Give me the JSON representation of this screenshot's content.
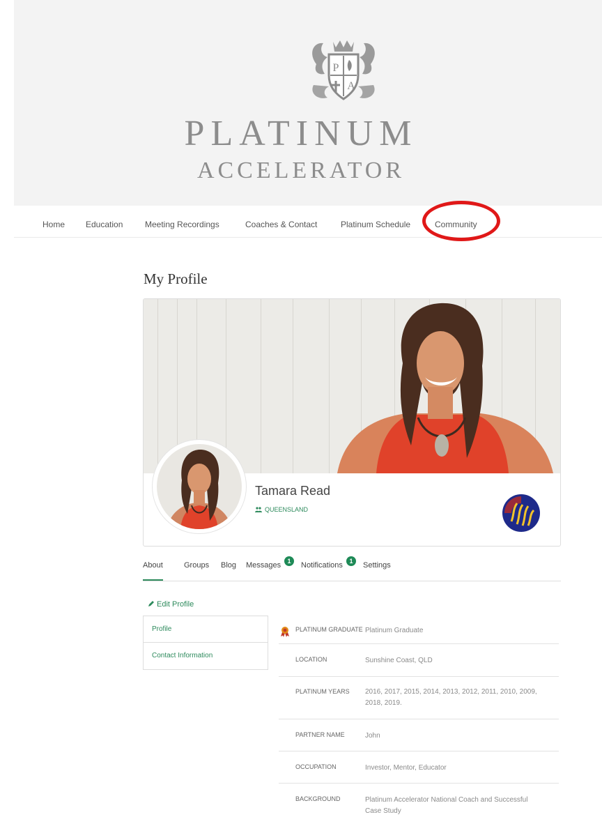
{
  "brand": {
    "line1": "PLATINUM",
    "line2": "ACCELERATOR",
    "crest_icon": "crest-icon"
  },
  "nav": {
    "items": [
      "Home",
      "Education",
      "Meeting Recordings",
      "Coaches & Contact",
      "Platinum Schedule",
      "Community"
    ],
    "highlighted": "Community"
  },
  "page": {
    "title": "My Profile"
  },
  "profile": {
    "name": "Tamara Read",
    "group": "QUEENSLAND"
  },
  "tabs": {
    "items": [
      "About",
      "Groups",
      "Blog",
      "Messages",
      "Notifications",
      "Settings"
    ],
    "active": "About",
    "messages_count": "1",
    "notifications_count": "1"
  },
  "edit_label": "Edit Profile",
  "sidebar": {
    "items": [
      "Profile",
      "Contact Information"
    ]
  },
  "fields": [
    {
      "label": "PLATINUM GRADUATE",
      "value": "Platinum Graduate"
    },
    {
      "label": "LOCATION",
      "value": "Sunshine Coast, QLD"
    },
    {
      "label": "PLATINUM YEARS",
      "value": "2016, 2017, 2015, 2014, 2013, 2012, 2011, 2010, 2009, 2018, 2019."
    },
    {
      "label": "PARTNER NAME",
      "value": "John"
    },
    {
      "label": "OCCUPATION",
      "value": "Investor, Mentor, Educator"
    },
    {
      "label": "BACKGROUND",
      "value": "Platinum Accelerator National Coach and Successful Case Study"
    }
  ],
  "colors": {
    "accent": "#2d8a5c",
    "highlight": "#e01818",
    "header_bg": "#f3f3f3"
  }
}
